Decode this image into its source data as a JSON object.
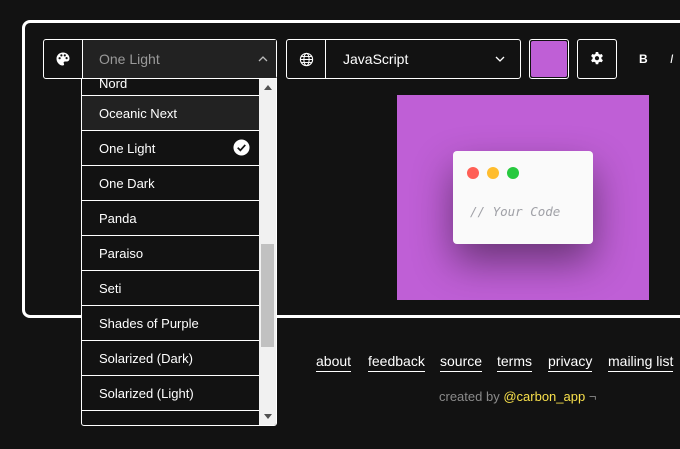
{
  "theme_picker": {
    "selected": "One Light",
    "icon": "palette-icon",
    "items": [
      {
        "label": "Nord"
      },
      {
        "label": "Oceanic Next"
      },
      {
        "label": "One Light"
      },
      {
        "label": "One Dark"
      },
      {
        "label": "Panda"
      },
      {
        "label": "Paraiso"
      },
      {
        "label": "Seti"
      },
      {
        "label": "Shades of Purple"
      },
      {
        "label": "Solarized (Dark)"
      },
      {
        "label": "Solarized (Light)"
      }
    ],
    "checked_item": "One Light",
    "hovered_item": "Oceanic Next"
  },
  "language_picker": {
    "icon": "globe-icon",
    "selected": "JavaScript"
  },
  "background_color": "#BF5FD6",
  "settings": {
    "icon": "gear-icon"
  },
  "format_buttons": {
    "bold": "B",
    "italic": "I"
  },
  "preview": {
    "code": "// Your Code",
    "window_controls": [
      "#ff5f56",
      "#ffbd2e",
      "#27c93f"
    ]
  },
  "footer": {
    "links": [
      "about",
      "feedback",
      "source",
      "terms",
      "privacy",
      "mailing list"
    ],
    "created_prefix": "created by",
    "handle": "@carbon_app",
    "handle_suffix": "¬"
  }
}
